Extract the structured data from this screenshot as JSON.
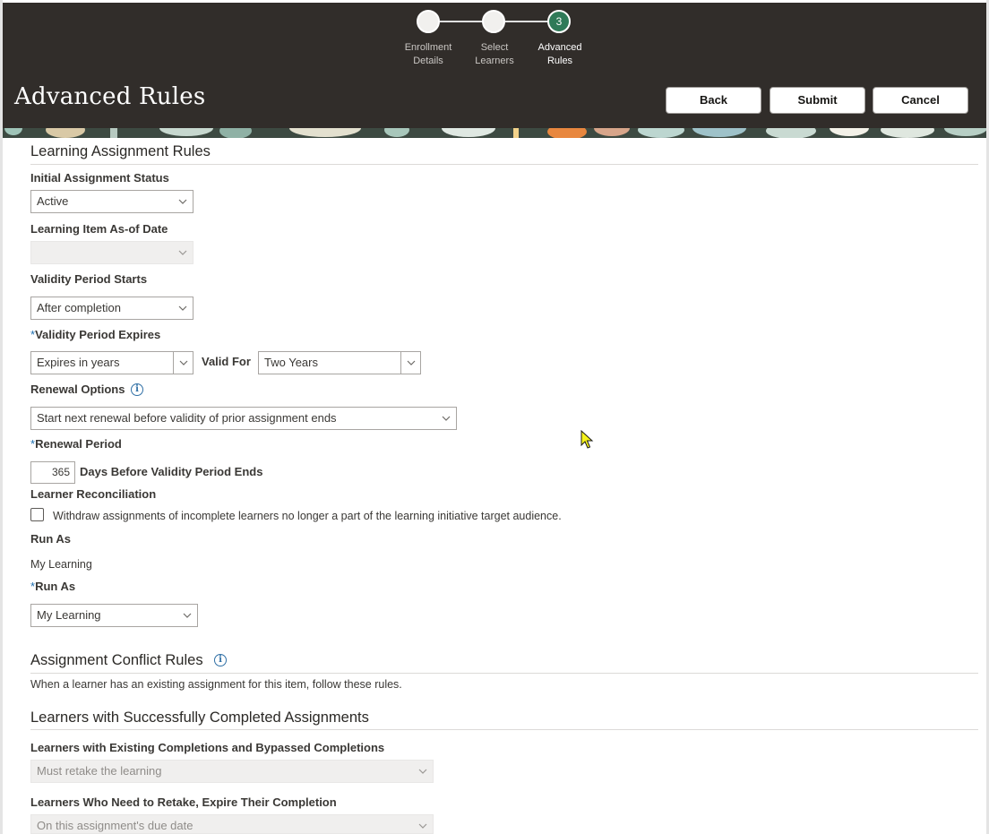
{
  "train": {
    "steps": [
      {
        "label_line1": "Enrollment",
        "label_line2": "Details",
        "state": "done"
      },
      {
        "label_line1": "Select Learners",
        "label_line2": "",
        "state": "done"
      },
      {
        "label_line1": "Advanced Rules",
        "label_line2": "",
        "state": "current",
        "number": "3"
      }
    ]
  },
  "header": {
    "title": "Advanced Rules",
    "back_label": "Back",
    "submit_label": "Submit",
    "cancel_label": "Cancel"
  },
  "learning_rules": {
    "section_title": "Learning Assignment Rules",
    "initial_status_label": "Initial Assignment Status",
    "initial_status_value": "Active",
    "as_of_date_label": "Learning Item As-of Date",
    "as_of_date_value": "",
    "validity_starts_label": "Validity Period Starts",
    "validity_starts_value": "After completion",
    "validity_expires_label": "Validity Period Expires",
    "validity_expires_value": "Expires in years",
    "valid_for_label": "Valid For",
    "valid_for_value": "Two Years",
    "renewal_options_label": "Renewal Options",
    "renewal_options_value": "Start next renewal before validity of prior assignment ends",
    "renewal_period_label": "Renewal Period",
    "renewal_period_value": "365",
    "renewal_period_suffix": "Days Before Validity Period Ends",
    "reconciliation_label": "Learner Reconciliation",
    "reconciliation_checkbox_text": "Withdraw assignments of incomplete learners no longer a part of the learning initiative target audience.",
    "run_as_label": "Run As",
    "run_as_readonly": "My Learning",
    "run_as_required_label": "Run As",
    "run_as_value": "My Learning",
    "required_marker": "*"
  },
  "conflict_rules": {
    "section_title": "Assignment Conflict Rules",
    "description": "When a learner has an existing assignment for this item, follow these rules."
  },
  "completed": {
    "section_title": "Learners with Successfully Completed Assignments",
    "existing_label": "Learners with Existing Completions and Bypassed Completions",
    "existing_value": "Must retake the learning",
    "retake_label": "Learners Who Need to Retake, Expire Their Completion",
    "retake_value": "On this assignment's due date"
  },
  "colors": {
    "header_bg": "#312d2a",
    "current_step": "#2f7a58",
    "required_marker": "#1e6fb0"
  }
}
